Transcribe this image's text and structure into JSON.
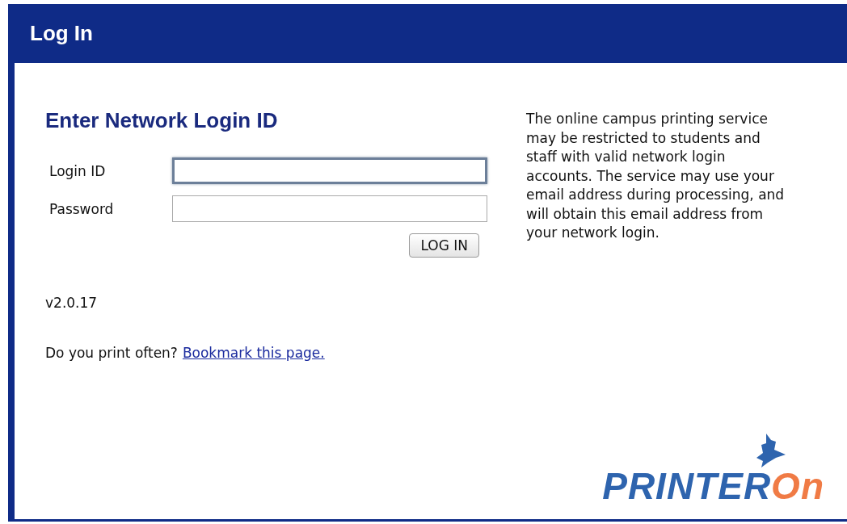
{
  "header": {
    "title": "Log In"
  },
  "form": {
    "heading": "Enter Network Login ID",
    "fields": [
      {
        "label": "Login ID",
        "focused": true
      },
      {
        "label": "Password",
        "focused": false
      }
    ],
    "submit": "LOG IN"
  },
  "version": "v2.0.17",
  "bookmark": {
    "text": "Do you print often?",
    "link": "Bookmark this page."
  },
  "notice": "The online campus printing service may be restricted to students and staff with valid network login accounts. The service may use your email address during processing, and will obtain this email address from your network login.",
  "logo": {
    "word_1": "PRINTER",
    "word_2": "On"
  }
}
